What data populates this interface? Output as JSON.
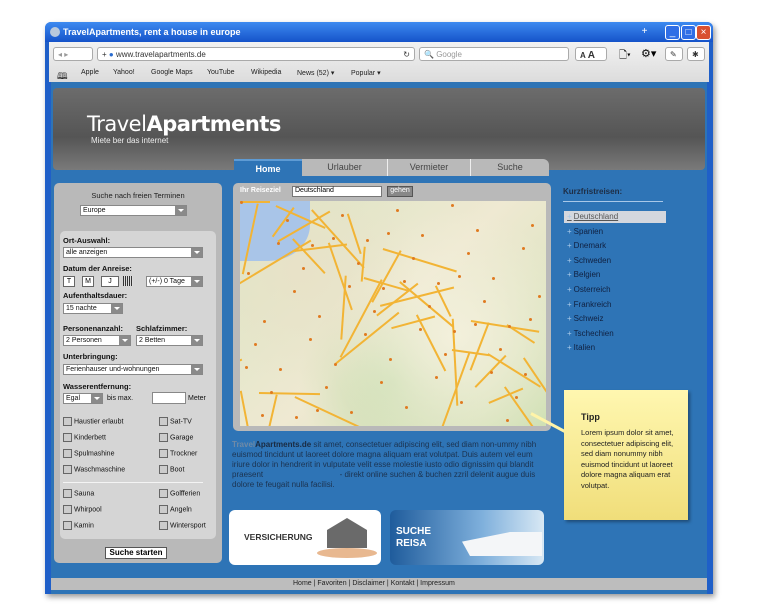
{
  "browser": {
    "title": "TravelApartments, rent a house in europe",
    "url": "www.travelapartments.de",
    "search_placeholder": "Google",
    "font_small": "A",
    "font_large": "A",
    "bookmarks": [
      "Apple",
      "Yahoo!",
      "Google Maps",
      "YouTube",
      "Wikipedia",
      "News (52) ▾",
      "Popular ▾"
    ]
  },
  "header": {
    "logo_light": "Travel",
    "logo_bold": "Apartments",
    "slogan": "Miete ber das internet"
  },
  "tabs": [
    {
      "label": "Home",
      "active": true
    },
    {
      "label": "Urlauber"
    },
    {
      "label": "Vermieter"
    },
    {
      "label": "Suche"
    }
  ],
  "search": {
    "title": "Suche nach freien Terminen",
    "region": "Europe",
    "ort_label": "Ort-Auswahl:",
    "ort_value": "alle anzeigen",
    "datum_label": "Datum der Anreise:",
    "day": "T",
    "month": "M",
    "year": "J",
    "tolerance": "(+/-) 0 Tage",
    "dauer_label": "Aufenthaltsdauer:",
    "dauer_value": "15 nachte",
    "personen_label": "Personenanzahl:",
    "personen_value": "2 Personen",
    "schlaf_label": "Schlafzimmer:",
    "schlaf_value": "2 Betten",
    "unterbringung_label": "Unterbringung:",
    "unterbringung_value": "Ferienhauser und-wohnungen",
    "wasser_label": "Wasserentfernung:",
    "wasser_value": "Egal",
    "bis_max": "bis max.",
    "meter": "Meter",
    "features_a": [
      [
        "Haustier erlaubt",
        "Sat-TV"
      ],
      [
        "Kinderbett",
        "Garage"
      ],
      [
        "Spulmashine",
        "Trockner"
      ],
      [
        "Waschmaschine",
        "Boot"
      ]
    ],
    "features_b": [
      [
        "Sauna",
        "Golfferien"
      ],
      [
        "Whirpool",
        "Angeln"
      ],
      [
        "Kamin",
        "Wintersport"
      ]
    ],
    "submit": "Suche starten"
  },
  "map": {
    "label": "Ihr Reiseziel",
    "value": "Deutschland",
    "go": "gehen"
  },
  "description": {
    "brand_light": "Travel",
    "brand_bold": "Apartments.de",
    "text1": " sit amet, consectetuer adipiscing elit, sed diam non-ummy nibh euismod tincidunt ut laoreet dolore magna aliquam erat volutpat. Duis autem vel eum iriure dolor in hendrerit in vulputate velit esse molestie iusto odio dignissim qui blandit praesent ",
    "text2": " - direkt online suchen & buchen  zzril delenit augue duis dolore te feugait nulla facilisi."
  },
  "kurz": {
    "title": "Kurzfristreisen:",
    "items": [
      "Deutschland",
      "Spanien",
      "Dnemark",
      "Schweden",
      "Belgien",
      "Osterreich",
      "Frankreich",
      "Schweiz",
      "Tschechien",
      "Italien"
    ]
  },
  "tipp": {
    "title": "Tipp",
    "text": "Lorem ipsum dolor sit amet, consectetuer adipiscing elit, sed diam nonummy nibh euismod tincidunt ut laoreet dolore magna aliquam erat volutpat."
  },
  "banners": {
    "insurance": "VERSICHERUNG",
    "cruise_1": "SUCHE",
    "cruise_2": "REISA"
  },
  "footer": [
    "Home",
    "Favoriten",
    "Disclaimer",
    "Kontakt",
    "Impressum"
  ]
}
